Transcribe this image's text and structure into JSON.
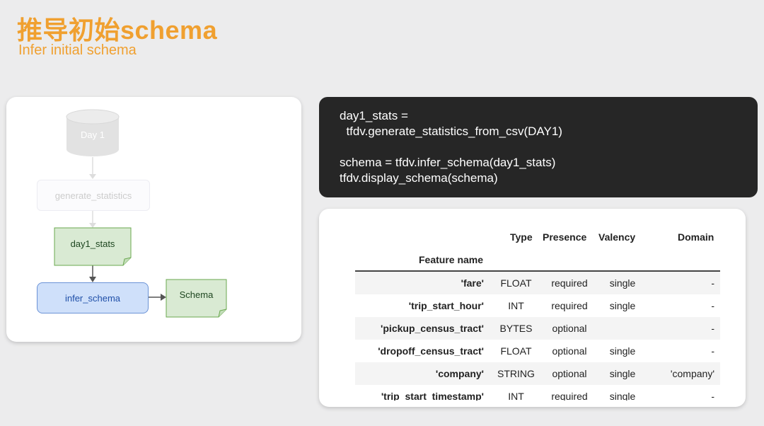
{
  "slide": {
    "title_zh": "推导初始schema",
    "title_en": "Infer initial schema"
  },
  "diagram": {
    "cylinder_label": "Day 1",
    "generate_label": "generate_statistics",
    "stats_label": "day1_stats",
    "infer_label": "infer_schema",
    "schema_label": "Schema",
    "colors": {
      "stats_fill": "#d9ead3",
      "infer_fill": "#cfe0fa",
      "schema_fill": "#d9ead3",
      "faded": "#e2e2e2"
    }
  },
  "code": {
    "text": "day1_stats =\n  tfdv.generate_statistics_from_csv(DAY1)\n\nschema = tfdv.infer_schema(day1_stats)\ntfdv.display_schema(schema)"
  },
  "table": {
    "headers": {
      "type": "Type",
      "presence": "Presence",
      "valency": "Valency",
      "domain": "Domain",
      "feature_name": "Feature name"
    },
    "rows": [
      {
        "name": "'fare'",
        "type": "FLOAT",
        "presence": "required",
        "valency": "single",
        "domain": "-"
      },
      {
        "name": "'trip_start_hour'",
        "type": "INT",
        "presence": "required",
        "valency": "single",
        "domain": "-"
      },
      {
        "name": "'pickup_census_tract'",
        "type": "BYTES",
        "presence": "optional",
        "valency": "",
        "domain": "-"
      },
      {
        "name": "'dropoff_census_tract'",
        "type": "FLOAT",
        "presence": "optional",
        "valency": "single",
        "domain": "-"
      },
      {
        "name": "'company'",
        "type": "STRING",
        "presence": "optional",
        "valency": "single",
        "domain": "'company'"
      },
      {
        "name": "'trip_start_timestamp'",
        "type": "INT",
        "presence": "required",
        "valency": "single",
        "domain": "-"
      }
    ]
  }
}
